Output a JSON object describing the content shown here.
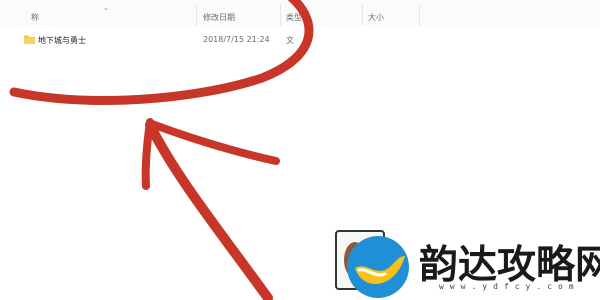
{
  "columns": {
    "name": "称",
    "date_modified": "修改日期",
    "type": "类型",
    "size": "大小"
  },
  "rows": [
    {
      "name": "地下城与勇士",
      "date_modified": "2018/7/15 21:24",
      "type": "文"
    }
  ],
  "watermark": {
    "title": "韵达攻略网",
    "url": "www.ydfcy.com"
  },
  "colors": {
    "annotation": "#c8362a",
    "folder": "#f3c33e",
    "logo_blue": "#1f8fd6",
    "logo_yellow": "#f6c21a"
  }
}
